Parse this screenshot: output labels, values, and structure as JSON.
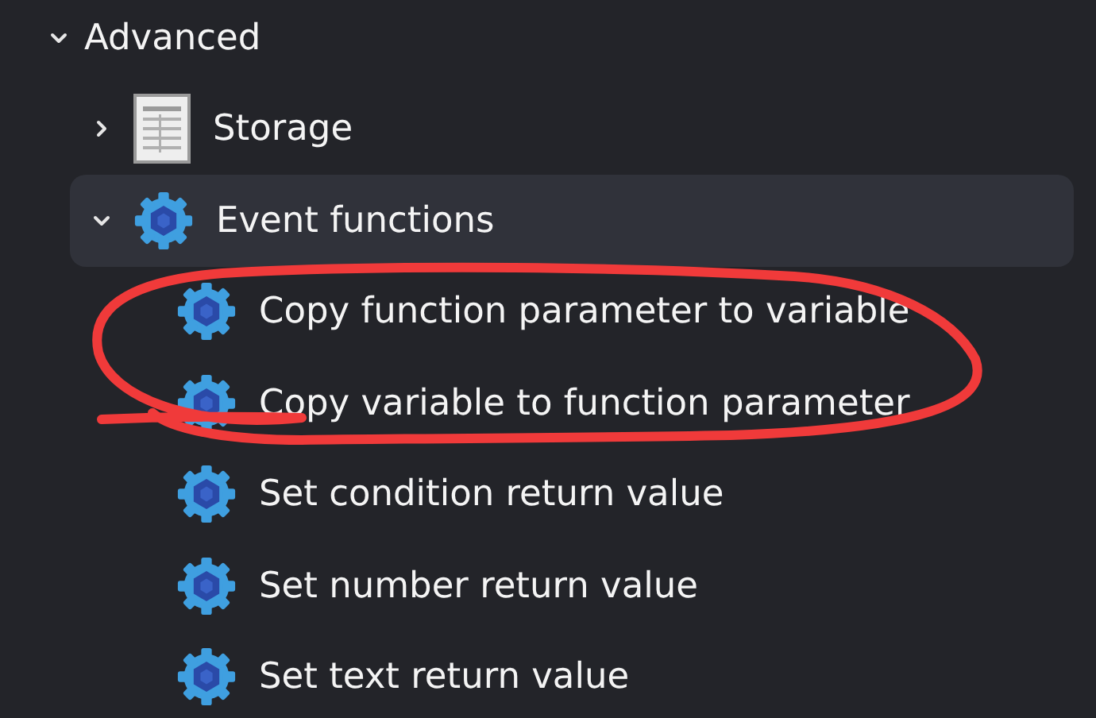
{
  "tree": [
    {
      "label": "Advanced",
      "expanded": true,
      "selected": false,
      "children": [
        {
          "label": "Storage",
          "kind": "table",
          "expanded": false,
          "selected": false
        },
        {
          "label": "Event functions",
          "kind": "gear",
          "expanded": true,
          "selected": true,
          "children": [
            {
              "label": "Copy function parameter to variable",
              "kind": "gear",
              "selected": false
            },
            {
              "label": "Copy variable to function parameter",
              "kind": "gear",
              "selected": false
            },
            {
              "label": "Set condition return value",
              "kind": "gear",
              "selected": false
            },
            {
              "label": "Set number return value",
              "kind": "gear",
              "selected": false
            },
            {
              "label": "Set text return value",
              "kind": "gear",
              "selected": false
            }
          ]
        }
      ]
    }
  ]
}
